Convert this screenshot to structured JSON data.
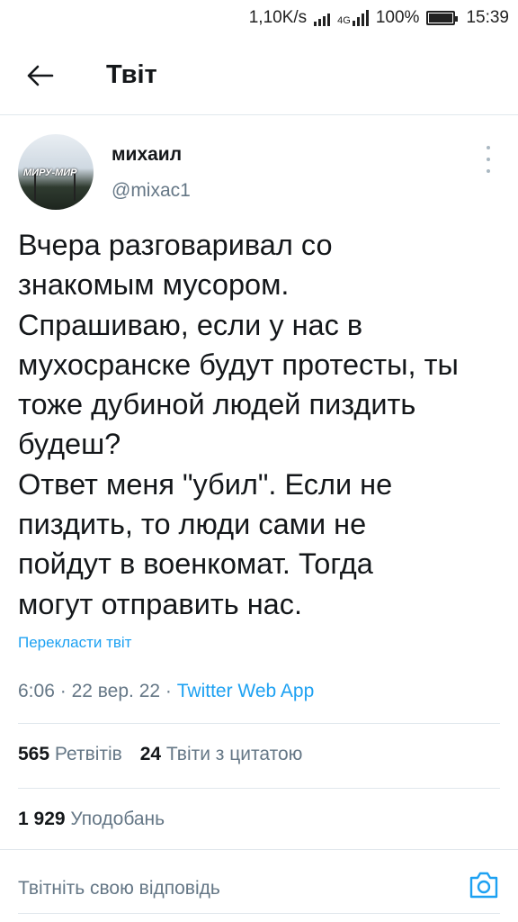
{
  "status_bar": {
    "network_speed": "1,10K/s",
    "network_type": "4G",
    "battery": "100%",
    "time": "15:39"
  },
  "header": {
    "title": "Твіт",
    "back_icon": "arrow-left-icon"
  },
  "tweet": {
    "author": {
      "name": "михаил",
      "handle": "@mixac1",
      "avatar_sign": "МИРУ-МИР"
    },
    "text": "Вчера разговаривал со\nзнакомым мусором.\nСпрашиваю, если у нас в\nмухосранске будут протесты, ты\nтоже дубиной людей пиздить\nбудеш?\nОтвет меня \"убил\". Если не\nпиздить, то люди сами не\nпойдут в военкомат. Тогда\nмогут отправить нас.",
    "translate_label": "Перекласти твіт",
    "time": "6:06",
    "date": "22 вер. 22",
    "source": "Twitter Web App",
    "separator": "·"
  },
  "stats": {
    "retweets_count": "565",
    "retweets_label": "Ретвітів",
    "quotes_count": "24",
    "quotes_label": "Твіти з цитатою",
    "likes_count": "1 929",
    "likes_label": "Уподобань"
  },
  "reply": {
    "placeholder": "Твітніть свою відповідь",
    "camera_icon": "camera-icon"
  },
  "colors": {
    "accent": "#1da1f2",
    "secondary_text": "#657786",
    "divider": "#e1e8ed"
  }
}
